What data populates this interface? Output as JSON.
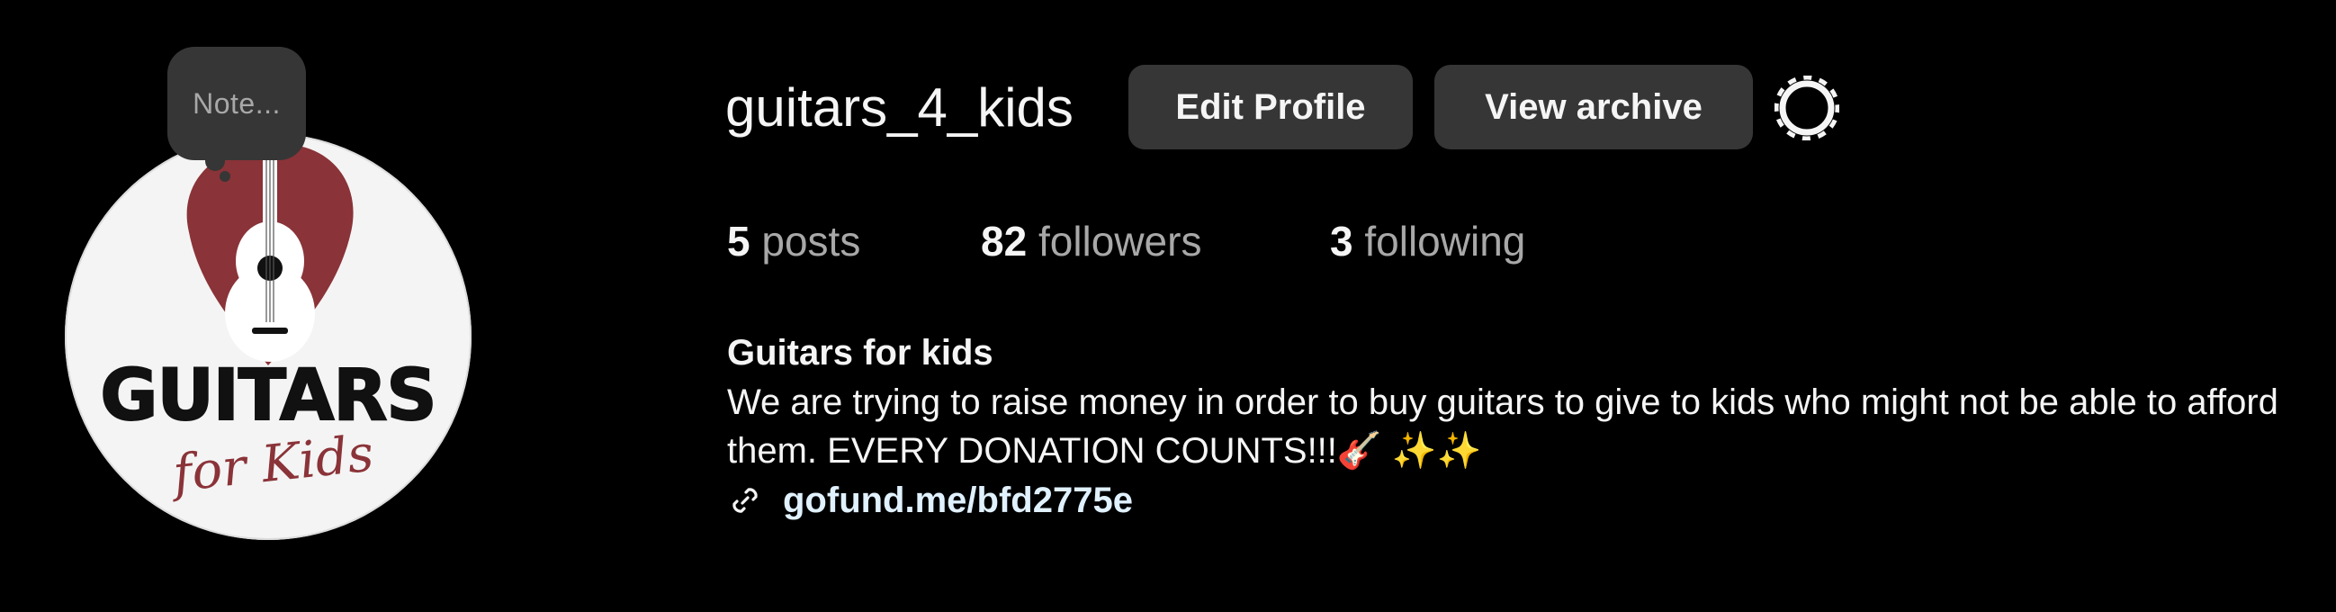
{
  "profile": {
    "username": "guitars_4_kids",
    "note_placeholder": "Note...",
    "avatar": {
      "icon": "guitars-for-kids-logo",
      "logo_title": "GUITARS",
      "logo_subtitle": "for Kids",
      "brand_color": "#8a3338"
    }
  },
  "buttons": {
    "edit_profile": "Edit Profile",
    "view_archive": "View archive",
    "settings_icon": "gear-icon"
  },
  "stats": {
    "posts_count": "5",
    "posts_label": "posts",
    "followers_count": "82",
    "followers_label": "followers",
    "following_count": "3",
    "following_label": "following"
  },
  "bio": {
    "name": "Guitars for kids",
    "text": "We are trying to raise money in order to buy guitars to give to kids who might not be able to afford them. EVERY DONATION COUNTS!!!🎸 ✨✨",
    "link_icon": "link-icon",
    "link": "gofund.me/bfd2775e"
  },
  "colors": {
    "background": "#000000",
    "button_bg": "#363636",
    "primary_text": "#f5f5f5",
    "secondary_text": "#a8a8a8",
    "link_text": "#e0f1ff"
  }
}
